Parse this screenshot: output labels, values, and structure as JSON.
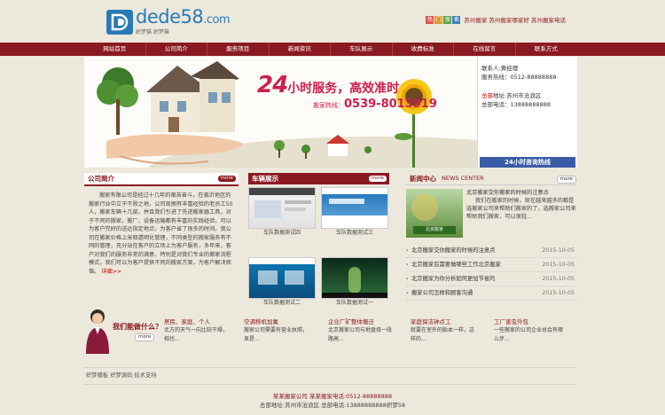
{
  "header": {
    "logo_text": "dede58",
    "logo_suffix": ".com",
    "logo_subtitle": "织梦猫 织梦猫",
    "hot_tags": [
      "热",
      "门",
      "搜",
      "索"
    ],
    "hot_links": "苏州搬家 苏州搬家哪家好 苏州搬家电话"
  },
  "nav": {
    "items": [
      "网站首页",
      "公司简介",
      "服务项目",
      "新闻资讯",
      "车队展示",
      "收费标准",
      "在线留言",
      "联系方式"
    ]
  },
  "banner": {
    "slogan_big": "24",
    "slogan_rest": "小时服务，高效准时",
    "phone_label": "搬家热线：",
    "phone": "0539-8013919"
  },
  "contact": {
    "person": "联系人:黄经理",
    "service_phone": "服务热线：0512-88888888",
    "hq_label": "总部",
    "hq_address": "地址:苏州市沧浪区",
    "hq_phone": "总部电话：13888888888",
    "button": "24小时咨询热线"
  },
  "about": {
    "title": "公司简介",
    "more": "more",
    "text": "搬家有限公司是经过十几年的艰苦奋斗，在临沂地区的搬家行业中立于不败之地，公司现拥有丰富经验的老员工50人，搬家车辆十几部，并且我们引进了先进搬家器工具，对于不同的搬家，搬厂，设备运输都有丰富的实践经验，可以为客户完好的送达指定地点，为客户省了很多的时间。我公司在搬家价格上采取透明化管理，不同类型的搬家服务有不同的管理，充分站在客户的立场上为客户服务，多年来，客户对我们的服务非常的满意，特别是对我们专业的搬家流程模式，我们可以为客户提供不同的搬家方案，为客户解决烦恼。",
    "detail": "详细>>"
  },
  "fleet": {
    "title": "车辆展示",
    "more": "more",
    "captions": [
      "车队数据测试四",
      "车队数据测试三",
      "车队数据测试二",
      "车队数据测试一"
    ]
  },
  "news": {
    "title": "新闻中心",
    "subtitle": "NEWS CENTER",
    "more": "more",
    "feature_title": "北京搬家交你搬家的时候的注意点",
    "feature_text": "我们在搬家的时候，现在越来越多的都是选搬家公司来帮助们搬家的了，选搬家公司来帮助我们搬家，可以很轻...",
    "feature_img_caption": "北京搬家",
    "items": [
      {
        "title": "北京搬家交你搬家的时候的注意点",
        "date": "2015-10-05"
      },
      {
        "title": "北京搬家后需要做哪些工作北京搬家",
        "date": "2015-10-05"
      },
      {
        "title": "北京搬家为你分析如何更加节省的",
        "date": "2015-10-05"
      },
      {
        "title": "搬家公司怎样和顾客沟通",
        "date": "2015-10-05"
      }
    ]
  },
  "services": {
    "heading": "我们能做什么？",
    "more": "more",
    "items": [
      {
        "title": "居民、家庭、个人",
        "desc": "北方的天气一向比较干燥，相也..."
      },
      {
        "title": "空调移机加氟",
        "desc": "搬家公司需要有营业执照，显是..."
      },
      {
        "title": "企业厂矿整体搬迁",
        "desc": "北京搬家公司与地盘择一段路高..."
      },
      {
        "title": "家庭保洁钟点工",
        "desc": "就要在室外的胎本一样，这样的..."
      },
      {
        "title": "工厂害虫外包",
        "desc": "一些搬家的公司企业总会有哪么步..."
      }
    ]
  },
  "links": {
    "text": "织梦模板 织梦源码 技术支持"
  },
  "footer": {
    "line1": "某某搬家公司 某某搬家电话:0512-88888888",
    "line2": "总部地址:苏州市沧浪区 总部电话:13888888888织梦58"
  },
  "colors": {
    "brand": "#8a1a22",
    "accent_blue": "#2a7ab8",
    "slogan": "#cc1f4d",
    "background": "#ede8dc"
  }
}
